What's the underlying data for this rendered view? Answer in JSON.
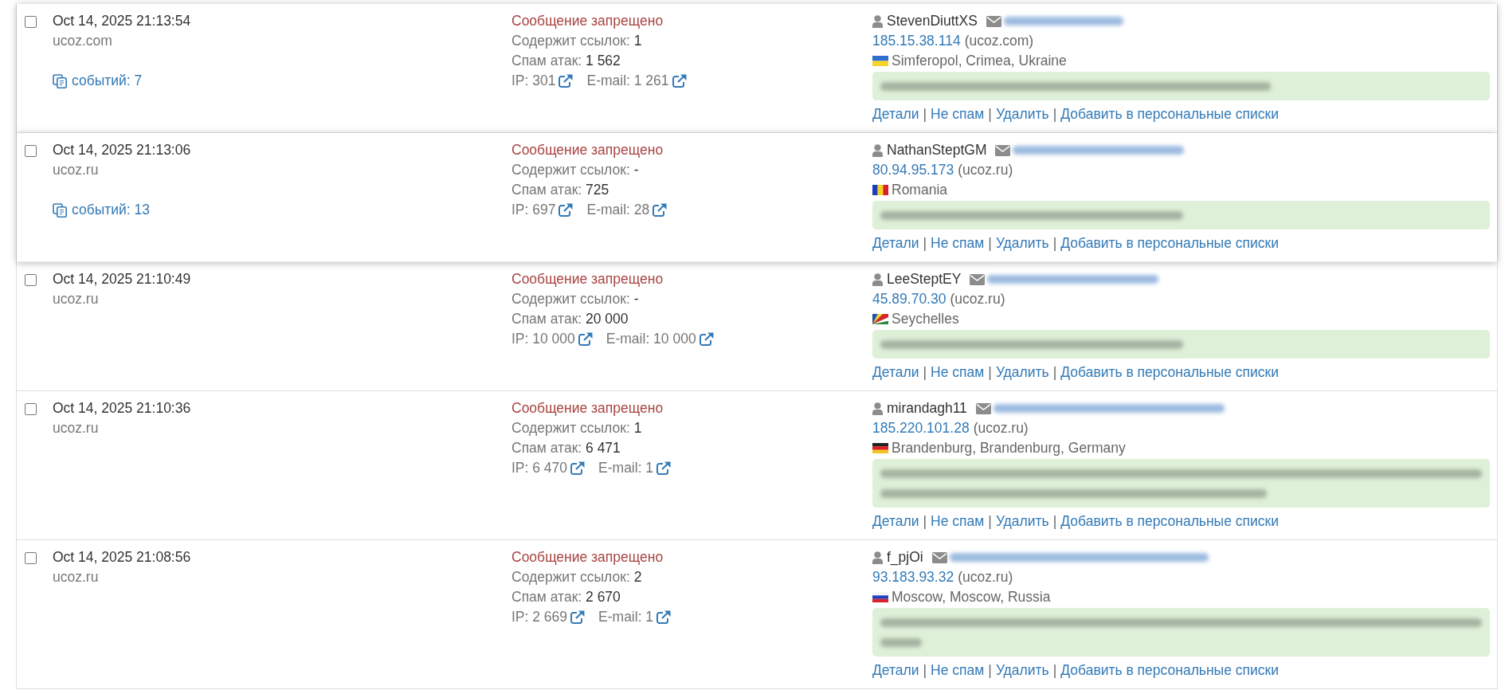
{
  "rows": [
    {
      "highlighted": true,
      "checked": false,
      "date": "Oct 14, 2025 21:13:54",
      "site": "ucoz.com",
      "events": "событий: 7",
      "status": "Сообщение запрещено",
      "links": {
        "label": "Содержит ссылок:",
        "value": "1"
      },
      "attacks": {
        "label": "Спам атак:",
        "value": "1 562"
      },
      "ip_hits": {
        "label": "IP:",
        "value": "301"
      },
      "email_hits": {
        "label": "E-mail:",
        "value": "1 261"
      },
      "user": "StevenDiuttXS",
      "email": {
        "kind": "short"
      },
      "ip": "185.15.38.114",
      "ip_site": "(ucoz.com)",
      "location": {
        "kind": "ukraine",
        "text": "Simferopol, Crimea, Ukraine"
      },
      "message": {
        "kind": "medium"
      },
      "actions": [
        {
          "kind": "link",
          "label": "Детали"
        },
        {
          "kind": "separator",
          "label": "|"
        },
        {
          "kind": "link",
          "label": "Не спам"
        },
        {
          "kind": "separator",
          "label": "|"
        },
        {
          "kind": "link",
          "label": "Удалить"
        },
        {
          "kind": "separator",
          "label": "|"
        },
        {
          "kind": "link",
          "label": "Добавить в персональные списки"
        }
      ]
    },
    {
      "highlighted": true,
      "checked": false,
      "date": "Oct 14, 2025 21:13:06",
      "site": "ucoz.ru",
      "events": "событий: 13",
      "status": "Сообщение запрещено",
      "links": {
        "label": "Содержит ссылок:",
        "value": "-"
      },
      "attacks": {
        "label": "Спам атак:",
        "value": "725"
      },
      "ip_hits": {
        "label": "IP:",
        "value": "697"
      },
      "email_hits": {
        "label": "E-mail:",
        "value": "28"
      },
      "user": "NathanSteptGM",
      "email": {
        "kind": "medium"
      },
      "ip": "80.94.95.173",
      "ip_site": "(ucoz.ru)",
      "location": {
        "kind": "romania",
        "text": "Romania"
      },
      "message": {
        "kind": "short"
      },
      "actions": [
        {
          "kind": "link",
          "label": "Детали"
        },
        {
          "kind": "separator",
          "label": "|"
        },
        {
          "kind": "link",
          "label": "Не спам"
        },
        {
          "kind": "separator",
          "label": "|"
        },
        {
          "kind": "link",
          "label": "Удалить"
        },
        {
          "kind": "separator",
          "label": "|"
        },
        {
          "kind": "link",
          "label": "Добавить в персональные списки"
        }
      ]
    },
    {
      "highlighted": false,
      "checked": false,
      "date": "Oct 14, 2025 21:10:49",
      "site": "ucoz.ru",
      "status": "Сообщение запрещено",
      "links": {
        "label": "Содержит ссылок:",
        "value": "-"
      },
      "attacks": {
        "label": "Спам атак:",
        "value": "20 000"
      },
      "ip_hits": {
        "label": "IP:",
        "value": "10 000"
      },
      "email_hits": {
        "label": "E-mail:",
        "value": "10 000"
      },
      "user": "LeeSteptEY",
      "email": {
        "kind": "medium"
      },
      "ip": "45.89.70.30",
      "ip_site": "(ucoz.ru)",
      "location": {
        "kind": "seychelles",
        "text": "Seychelles"
      },
      "message": {
        "kind": "short"
      },
      "actions": [
        {
          "kind": "link",
          "label": "Детали"
        },
        {
          "kind": "separator",
          "label": "|"
        },
        {
          "kind": "link",
          "label": "Не спам"
        },
        {
          "kind": "separator",
          "label": "|"
        },
        {
          "kind": "link",
          "label": "Удалить"
        },
        {
          "kind": "separator",
          "label": "|"
        },
        {
          "kind": "link",
          "label": "Добавить в персональные списки"
        }
      ]
    },
    {
      "highlighted": false,
      "checked": false,
      "date": "Oct 14, 2025 21:10:36",
      "site": "ucoz.ru",
      "status": "Сообщение запрещено",
      "links": {
        "label": "Содержит ссылок:",
        "value": "1"
      },
      "attacks": {
        "label": "Спам атак:",
        "value": "6 471"
      },
      "ip_hits": {
        "label": "IP:",
        "value": "6 470"
      },
      "email_hits": {
        "label": "E-mail:",
        "value": "1"
      },
      "user": "mirandagh11",
      "email": {
        "kind": "long"
      },
      "ip": "185.220.101.28",
      "ip_site": "(ucoz.ru)",
      "location": {
        "kind": "germany",
        "text": "Brandenburg, Brandenburg, Germany"
      },
      "message": {
        "kind": "long"
      },
      "actions": [
        {
          "kind": "link",
          "label": "Детали"
        },
        {
          "kind": "separator",
          "label": "|"
        },
        {
          "kind": "link",
          "label": "Не спам"
        },
        {
          "kind": "separator",
          "label": "|"
        },
        {
          "kind": "link",
          "label": "Удалить"
        },
        {
          "kind": "separator",
          "label": "|"
        },
        {
          "kind": "link",
          "label": "Добавить в персональные списки"
        }
      ]
    },
    {
      "highlighted": false,
      "checked": false,
      "date": "Oct 14, 2025 21:08:56",
      "site": "ucoz.ru",
      "status": "Сообщение запрещено",
      "links": {
        "label": "Содержит ссылок:",
        "value": "2"
      },
      "attacks": {
        "label": "Спам атак:",
        "value": "2 670"
      },
      "ip_hits": {
        "label": "IP:",
        "value": "2 669"
      },
      "email_hits": {
        "label": "E-mail:",
        "value": "1"
      },
      "user": "f_pjOi",
      "email": {
        "kind": "longest"
      },
      "ip": "93.183.93.32",
      "ip_site": "(ucoz.ru)",
      "location": {
        "kind": "russia",
        "text": "Moscow, Moscow, Russia"
      },
      "message": {
        "kind": "wrapping"
      },
      "actions": [
        {
          "kind": "link",
          "label": "Детали"
        },
        {
          "kind": "separator",
          "label": "|"
        },
        {
          "kind": "link",
          "label": "Не спам"
        },
        {
          "kind": "separator",
          "label": "|"
        },
        {
          "kind": "link",
          "label": "Удалить"
        },
        {
          "kind": "separator",
          "label": "|"
        },
        {
          "kind": "link",
          "label": "Добавить в персональные списки"
        }
      ]
    }
  ]
}
